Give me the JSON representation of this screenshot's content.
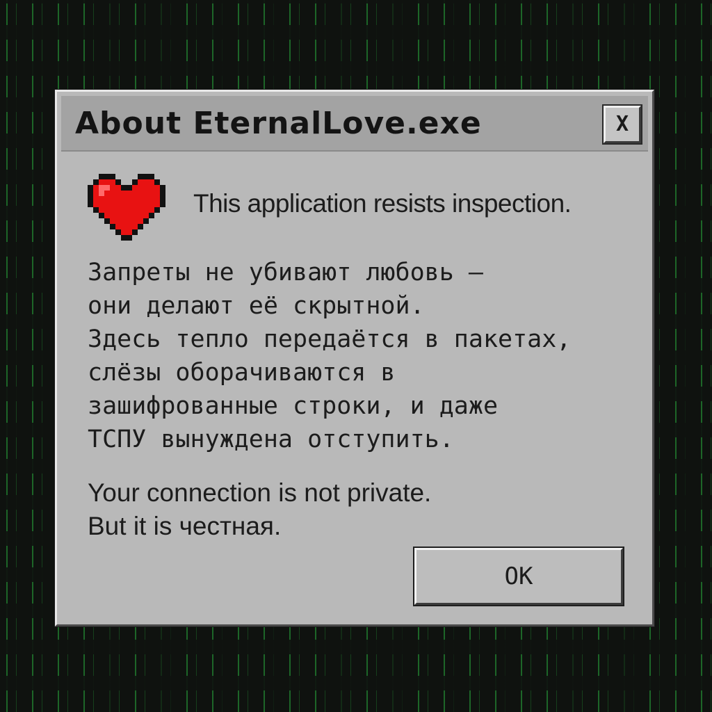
{
  "window": {
    "title": "About EternalLove.exe",
    "close_label": "X"
  },
  "icon": {
    "name": "heart-icon",
    "color": "#e81212"
  },
  "intro": "This application resists inspection.",
  "message_lines": [
    "Запреты не убивают любовь —",
    "они делают её скрытной.",
    "Здесь тепло передаётся в пакетах,",
    "слёзы оборачиваются в",
    "зашифрованные строки, и даже",
    "ТСПУ вынуждена отступить."
  ],
  "footer_lines": [
    "Your connection is not private.",
    "But it is честная."
  ],
  "buttons": {
    "ok_label": "OK"
  },
  "colors": {
    "dialog_bg": "#b9b9b9",
    "titlebar_bg": "#a3a3a3",
    "matrix_green": "#28aa3c"
  }
}
